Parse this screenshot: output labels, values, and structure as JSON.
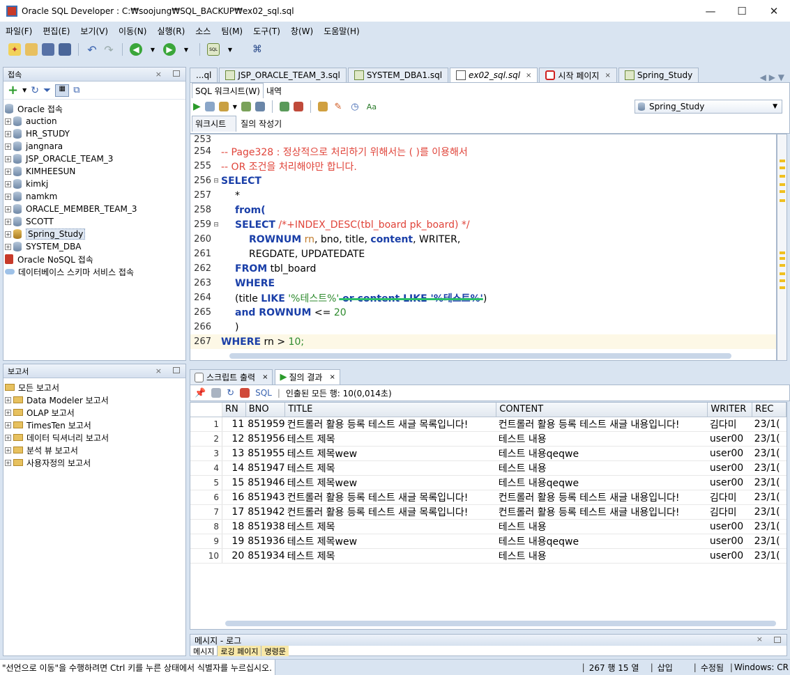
{
  "window": {
    "title": "Oracle SQL Developer : C:₩soojung₩SQL_BACKUP₩ex02_sql.sql",
    "minimize": "—",
    "maximize": "☐",
    "close": "✕"
  },
  "menu": [
    "파일(F)",
    "편집(E)",
    "보기(V)",
    "이동(N)",
    "실행(R)",
    "소스",
    "팀(M)",
    "도구(T)",
    "창(W)",
    "도움말(H)"
  ],
  "connections": {
    "title": "접속",
    "root": "Oracle 접속",
    "items": [
      "auction",
      "HR_STUDY",
      "jangnara",
      "JSP_ORACLE_TEAM_3",
      "KIMHEESUN",
      "kimkj",
      "namkm",
      "ORACLE_MEMBER_TEAM_3",
      "SCOTT",
      "Spring_Study",
      "SYSTEM_DBA"
    ],
    "nosql": "Oracle NoSQL 접속",
    "schema_service": "데이터베이스 스키마 서비스 접속"
  },
  "reports": {
    "title": "보고서",
    "root": "모든 보고서",
    "items": [
      "Data Modeler 보고서",
      "OLAP 보고서",
      "TimesTen 보고서",
      "데이터 딕셔너리 보고서",
      "분석 뷰 보고서",
      "사용자정의 보고서"
    ]
  },
  "doc_tabs": [
    {
      "label": "...ql"
    },
    {
      "label": "JSP_ORACLE_TEAM_3.sql"
    },
    {
      "label": "SYSTEM_DBA1.sql"
    },
    {
      "label": "ex02_sql.sql"
    },
    {
      "label": "시작 페이지"
    },
    {
      "label": "Spring_Study"
    }
  ],
  "worksheet": {
    "tab_worksheet": "SQL 워크시트(W)",
    "tab_history": "내역",
    "connection": "Spring_Study",
    "sub_tab1": "워크시트",
    "sub_tab2": "질의 작성기"
  },
  "code": {
    "l253": "253",
    "l254": "254",
    "l255": "255",
    "l256": "256",
    "l257": "257",
    "l258": "258",
    "l259": "259",
    "l260": "260",
    "l261": "261",
    "l262": "262",
    "l263": "263",
    "l264": "264",
    "l265": "265",
    "l266": "266",
    "l267": "267",
    "c254": "-- Page328 : 정상적으로 처리하기 위해서는 ( )를 이용해서",
    "c255": "-- OR 조건을 처리해야만 합니다.",
    "select": "SELECT",
    "star": "*",
    "from_open": "from(",
    "select2": "SELECT",
    "hint": "/*+INDEX_DESC(tbl_board pk_board) */",
    "rownum": "ROWNUM",
    "rn": "rn",
    "cols1": ", bno, title, ",
    "content_kw": "content",
    "cols2": ", WRITER,",
    "cols3": "REGDATE, UPDATEDATE",
    "from_kw": "FROM",
    "tbl": " tbl_board",
    "where_kw": "WHERE",
    "p264a": "(title ",
    "like1": "LIKE",
    "str1": " '%테스트%'",
    "struck": " or content LIKE '%테스트%'",
    "p264b": ")",
    "and_kw": "and ROWNUM",
    "le": " <= ",
    "twenty": "20",
    "close": ")",
    "where2": "WHERE",
    "rngt": " rn > ",
    "ten": "10;"
  },
  "output": {
    "tab_script": "스크립트 출력",
    "tab_result": "질의 결과",
    "sql_label": "SQL",
    "fetched": "인출된 모든 행: 10(0,014초)"
  },
  "results": {
    "columns": [
      "RN",
      "BNO",
      "TITLE",
      "CONTENT",
      "WRITER",
      "REC"
    ],
    "rows": [
      {
        "i": "1",
        "rn": "11",
        "bno": "851959",
        "title": "컨트롤러 활용 등록 테스트 새글 목록입니다!",
        "content": "컨트롤러 활용 등록 테스트 새글 내용입니다!",
        "writer": "김다미",
        "reg": "23/1("
      },
      {
        "i": "2",
        "rn": "12",
        "bno": "851956",
        "title": "테스트 제목",
        "content": "테스트 내용",
        "writer": "user00",
        "reg": "23/1("
      },
      {
        "i": "3",
        "rn": "13",
        "bno": "851955",
        "title": "테스트 제목wew",
        "content": "테스트 내용qeqwe",
        "writer": "user00",
        "reg": "23/1("
      },
      {
        "i": "4",
        "rn": "14",
        "bno": "851947",
        "title": "테스트 제목",
        "content": "테스트 내용",
        "writer": "user00",
        "reg": "23/1("
      },
      {
        "i": "5",
        "rn": "15",
        "bno": "851946",
        "title": "테스트 제목wew",
        "content": "테스트 내용qeqwe",
        "writer": "user00",
        "reg": "23/1("
      },
      {
        "i": "6",
        "rn": "16",
        "bno": "851943",
        "title": "컨트롤러 활용 등록 테스트 새글 목록입니다!",
        "content": "컨트롤러 활용 등록 테스트 새글 내용입니다!",
        "writer": "김다미",
        "reg": "23/1("
      },
      {
        "i": "7",
        "rn": "17",
        "bno": "851942",
        "title": "컨트롤러 활용 등록 테스트 새글 목록입니다!",
        "content": "컨트롤러 활용 등록 테스트 새글 내용입니다!",
        "writer": "김다미",
        "reg": "23/1("
      },
      {
        "i": "8",
        "rn": "18",
        "bno": "851938",
        "title": "테스트 제목",
        "content": "테스트 내용",
        "writer": "user00",
        "reg": "23/1("
      },
      {
        "i": "9",
        "rn": "19",
        "bno": "851936",
        "title": "테스트 제목wew",
        "content": "테스트 내용qeqwe",
        "writer": "user00",
        "reg": "23/1("
      },
      {
        "i": "10",
        "rn": "20",
        "bno": "851934",
        "title": "테스트 제목",
        "content": "테스트 내용",
        "writer": "user00",
        "reg": "23/1("
      }
    ]
  },
  "log": {
    "title": "메시지 - 로그",
    "tab1": "메시지",
    "tab2": "로깅 페이지",
    "tab3": "명령문"
  },
  "statusbar": {
    "hint": "\"선언으로 이동\"을 수행하려면 Ctrl 키를 누른 상태에서 식별자를 누르십시오.",
    "position": "267 행 15 열",
    "mode": "삽입",
    "modified": "수정됨",
    "eol": "Windows: CR"
  }
}
